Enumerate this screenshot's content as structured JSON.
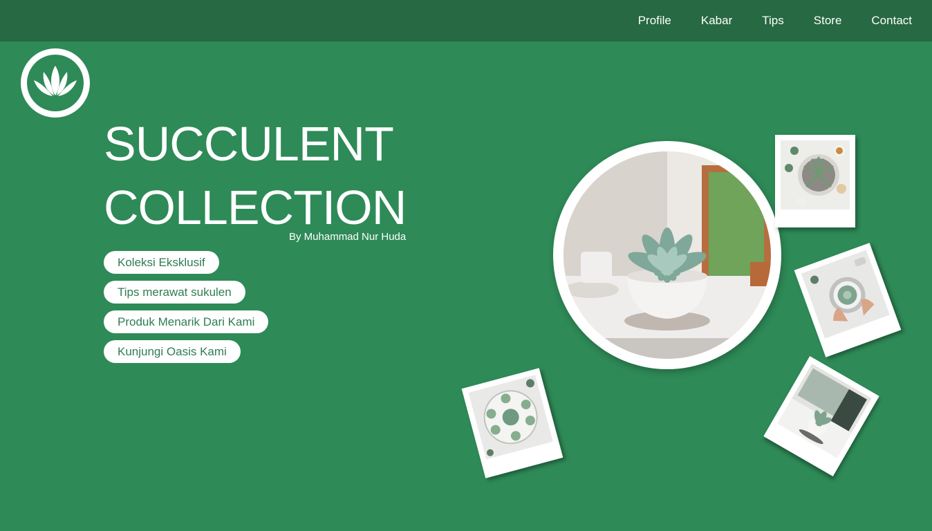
{
  "nav": {
    "items": [
      "Profile",
      "Kabar",
      "Tips",
      "Store",
      "Contact"
    ]
  },
  "logo": {
    "icon": "lotus-leaves-icon"
  },
  "hero": {
    "title_line1": "SUCCULENT",
    "title_line2": "COLLECTION",
    "byline": "By Muhammad Nur Huda"
  },
  "pills": [
    "Koleksi Eksklusif",
    "Tips merawat sukulen",
    "Produk Menarik Dari Kami",
    "Kunjungi Oasis Kami"
  ],
  "colors": {
    "background": "#2e8a57",
    "navbar": "#266943",
    "pill_text": "#2e7d52",
    "white": "#ffffff"
  }
}
